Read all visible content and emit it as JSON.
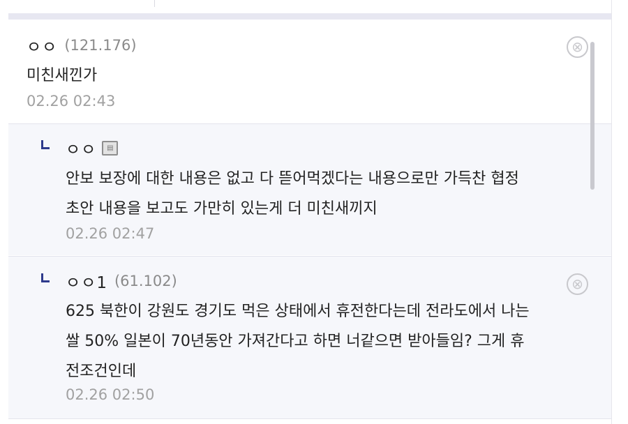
{
  "comments": [
    {
      "nick": "ㅇㅇ",
      "ip": "(121.176)",
      "body": "미친새낀가",
      "date": "02.26 02:43",
      "delete_glyph": "⊗"
    }
  ],
  "replies": [
    {
      "nick": "ㅇㅇ",
      "mobile_icon": "mobile-icon",
      "lines": [
        "안보 보장에 대한 내용은 없고 다 뜯어먹겠다는 내용으로만 가득찬 협정",
        "초안 내용을 보고도 가만히 있는게 더 미친새끼지"
      ],
      "date": "02.26 02:47"
    },
    {
      "nick": "ㅇㅇ1",
      "ip": "(61.102)",
      "lines": [
        "625 북한이 강원도 경기도 먹은 상태에서 휴전한다는데 전라도에서 나는",
        "쌀 50% 일본이 70년동안 가져간다고 하면 너같으면 받아들임? 그게 휴",
        "전조건인데"
      ],
      "date": "02.26 02:50",
      "delete_glyph": "⊗"
    }
  ],
  "colors": {
    "reply_bg": "#f6f7fb",
    "reply_mark": "#2e3a8c",
    "muted_text": "#a1a1a1",
    "separator": "#e7e7f1"
  }
}
